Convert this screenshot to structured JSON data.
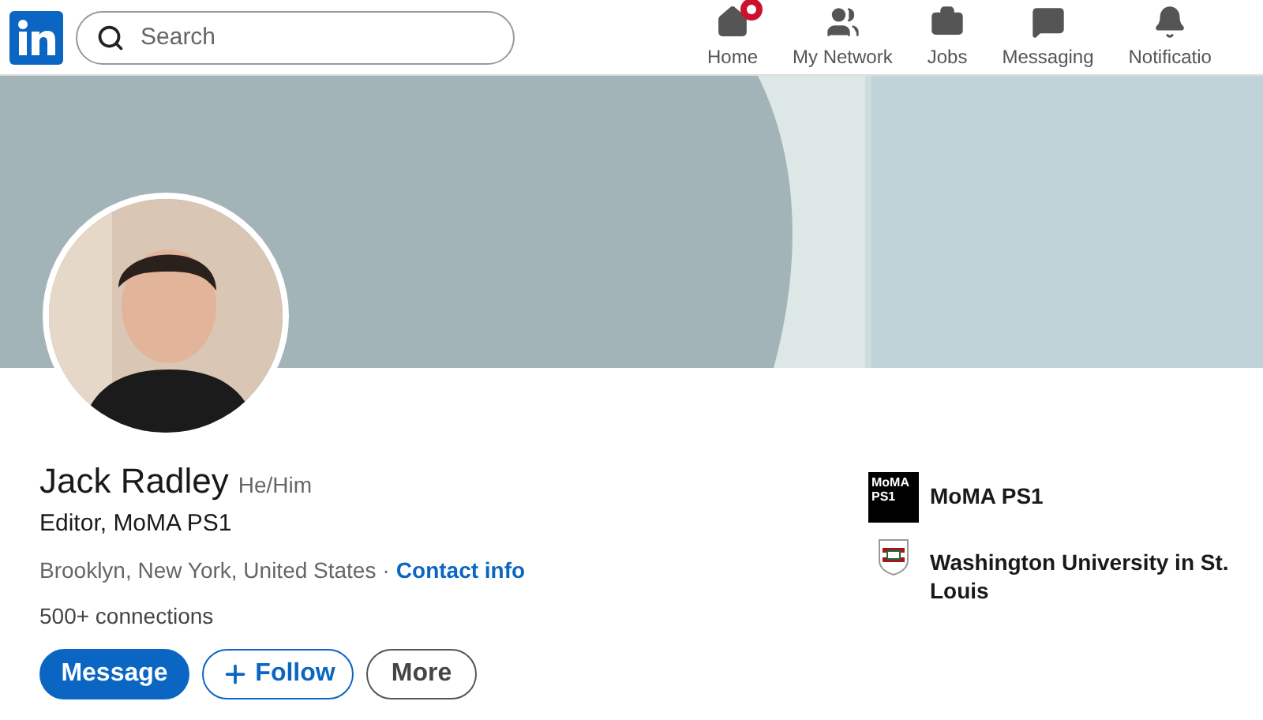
{
  "nav": {
    "search": {
      "placeholder": "Search"
    },
    "items": [
      {
        "label": "Home",
        "has_badge": true
      },
      {
        "label": "My Network",
        "has_badge": false
      },
      {
        "label": "Jobs",
        "has_badge": false
      },
      {
        "label": "Messaging",
        "has_badge": false
      },
      {
        "label": "Notificatio",
        "has_badge": false
      }
    ]
  },
  "profile": {
    "name": "Jack Radley",
    "pronouns": "He/Him",
    "headline": "Editor, MoMA PS1",
    "location": "Brooklyn, New York, United States",
    "separator": "·",
    "contact_link": "Contact info",
    "connections": "500+ connections",
    "buttons": [
      {
        "label": "Message",
        "kind": "primary"
      },
      {
        "label": "Follow",
        "kind": "follow"
      },
      {
        "label": "More",
        "kind": "secondary"
      }
    ]
  },
  "affiliations": [
    {
      "kind": "company",
      "name": "MoMA PS1",
      "logo_text": [
        "MoMA",
        "PS1"
      ]
    },
    {
      "kind": "school",
      "name": "Washington University in St. Louis"
    }
  ]
}
